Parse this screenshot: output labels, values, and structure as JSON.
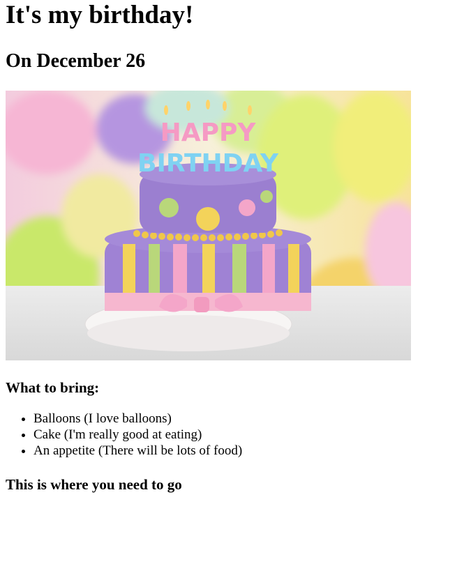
{
  "page": {
    "title": "It's my birthday!",
    "date_heading": "On December 26",
    "image": {
      "description_icon": "birthday-cake-image",
      "candle_letters_top": "HAPPY",
      "candle_letters_bottom": "BIRTHDAY"
    },
    "bring_heading": "What to bring:",
    "bring_items": [
      "Balloons (I love balloons)",
      "Cake (I'm really good at eating)",
      "An appetite (There will be lots of food)"
    ],
    "where_heading": "This is where you need to go"
  },
  "colors": {
    "cake_purple": "#9b7fd0",
    "cake_pink": "#f4a6c9",
    "cake_yellow": "#f3d35a",
    "cake_green": "#b9d77a",
    "plate_white": "#f4f2f1"
  }
}
